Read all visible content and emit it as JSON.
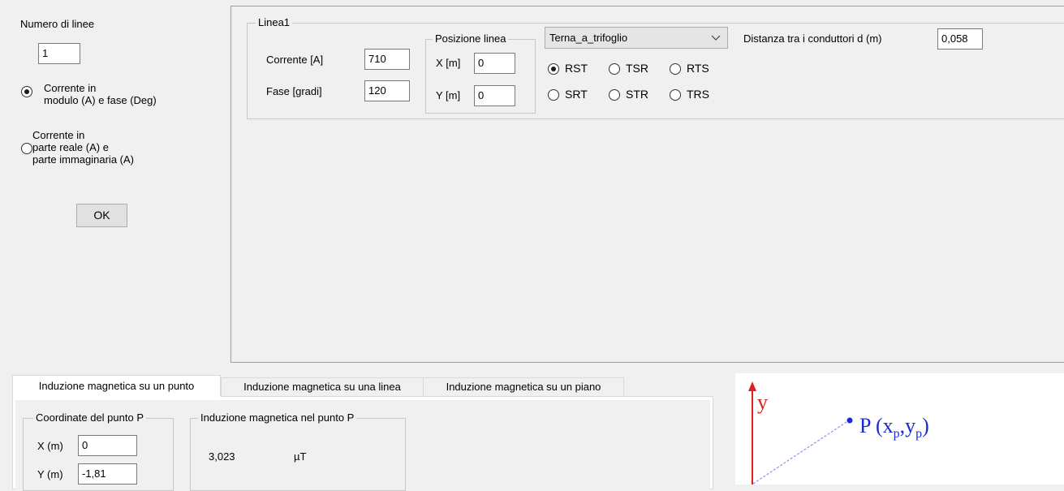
{
  "left_panel": {
    "num_lines_label": "Numero di linee",
    "num_lines_value": "1",
    "mode_options": [
      {
        "lines": [
          "Corrente in",
          "modulo (A) e fase (Deg)"
        ],
        "selected": true
      },
      {
        "lines": [
          "Corrente in",
          "parte reale (A) e",
          "parte immaginaria (A)"
        ],
        "selected": false
      }
    ],
    "ok_label": "OK"
  },
  "line_group": {
    "title": "Linea1",
    "current_label": "Corrente [A]",
    "current_value": "710",
    "phase_label": "Fase [gradi]",
    "phase_value": "120",
    "position": {
      "title": "Posizione linea",
      "x_label": "X [m]",
      "x_value": "0",
      "y_label": "Y [m]",
      "y_value": "0"
    },
    "config_select": "Terna_a_trifoglio",
    "phase_orders": [
      {
        "label": "RST",
        "selected": true
      },
      {
        "label": "TSR",
        "selected": false
      },
      {
        "label": "RTS",
        "selected": false
      },
      {
        "label": "SRT",
        "selected": false
      },
      {
        "label": "STR",
        "selected": false
      },
      {
        "label": "TRS",
        "selected": false
      }
    ],
    "distance_label": "Distanza tra i conduttori d (m)",
    "distance_value": "0,058"
  },
  "tabs": [
    {
      "label": "Induzione magnetica su un punto",
      "active": true
    },
    {
      "label": "Induzione magnetica su una linea",
      "active": false
    },
    {
      "label": "Induzione magnetica su un piano",
      "active": false
    }
  ],
  "point_tab": {
    "coords_title": "Coordinate del punto P",
    "x_label": "X (m)",
    "x_value": "0",
    "y_label": "Y (m)",
    "y_value": "-1,81",
    "induction_title": "Induzione magnetica nel punto P",
    "induction_value": "3,023",
    "induction_unit": "µT"
  },
  "diagram": {
    "axis_label": "y",
    "point_label_prefix": "P (x",
    "sub_p": "p",
    "comma": ",y",
    "close": ")",
    "axis_color": "#e02020",
    "point_color": "#1a2ad8"
  }
}
